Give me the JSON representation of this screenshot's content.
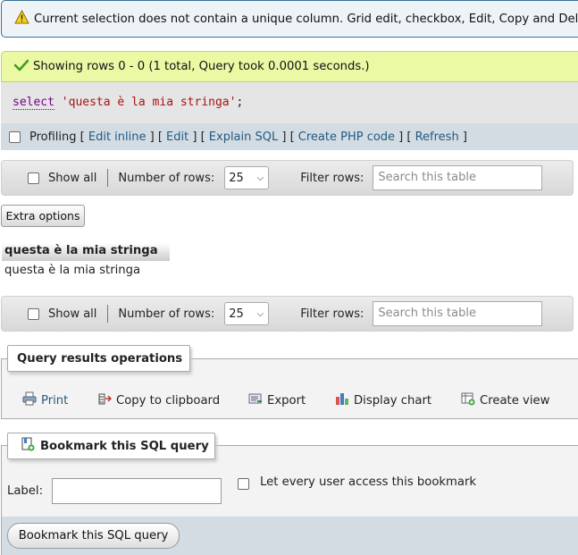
{
  "notice": {
    "icon": "warning-icon",
    "text": "Current selection does not contain a unique column. Grid edit, checkbox, Edit, Copy and Delete features are not available."
  },
  "success": {
    "icon": "checkmark-icon",
    "text": "Showing rows 0 - 0 (1 total, Query took 0.0001 seconds.)"
  },
  "sql": {
    "keyword": "select",
    "string": "'questa è la mia stringa'",
    "terminator": ";"
  },
  "profiling": {
    "label": "Profiling",
    "links": [
      "Edit inline",
      "Edit",
      "Explain SQL",
      "Create PHP code",
      "Refresh"
    ]
  },
  "navbar": {
    "show_all": "Show all",
    "number_of_rows_label": "Number of rows:",
    "number_of_rows_value": "25",
    "filter_label": "Filter rows:",
    "filter_placeholder": "Search this table"
  },
  "extra_options": "Extra options",
  "results": {
    "column": "questa è la mia stringa",
    "rows": [
      "questa è la mia stringa"
    ]
  },
  "query_ops": {
    "legend": "Query results operations",
    "items": [
      {
        "label": "Print",
        "icon": "print-icon"
      },
      {
        "label": "Copy to clipboard",
        "icon": "clipboard-icon"
      },
      {
        "label": "Export",
        "icon": "export-icon"
      },
      {
        "label": "Display chart",
        "icon": "chart-icon"
      },
      {
        "label": "Create view",
        "icon": "create-view-icon"
      }
    ]
  },
  "bookmark": {
    "legend": "Bookmark this SQL query",
    "label": "Label:",
    "label_value": "",
    "public_label": "Let every user access this bookmark",
    "submit": "Bookmark this SQL query"
  },
  "colors": {
    "link": "#235a81",
    "success_bg": "#ebf8a4",
    "notice_bg": "#eef3f8",
    "bar_bg": "#d3dce3"
  }
}
